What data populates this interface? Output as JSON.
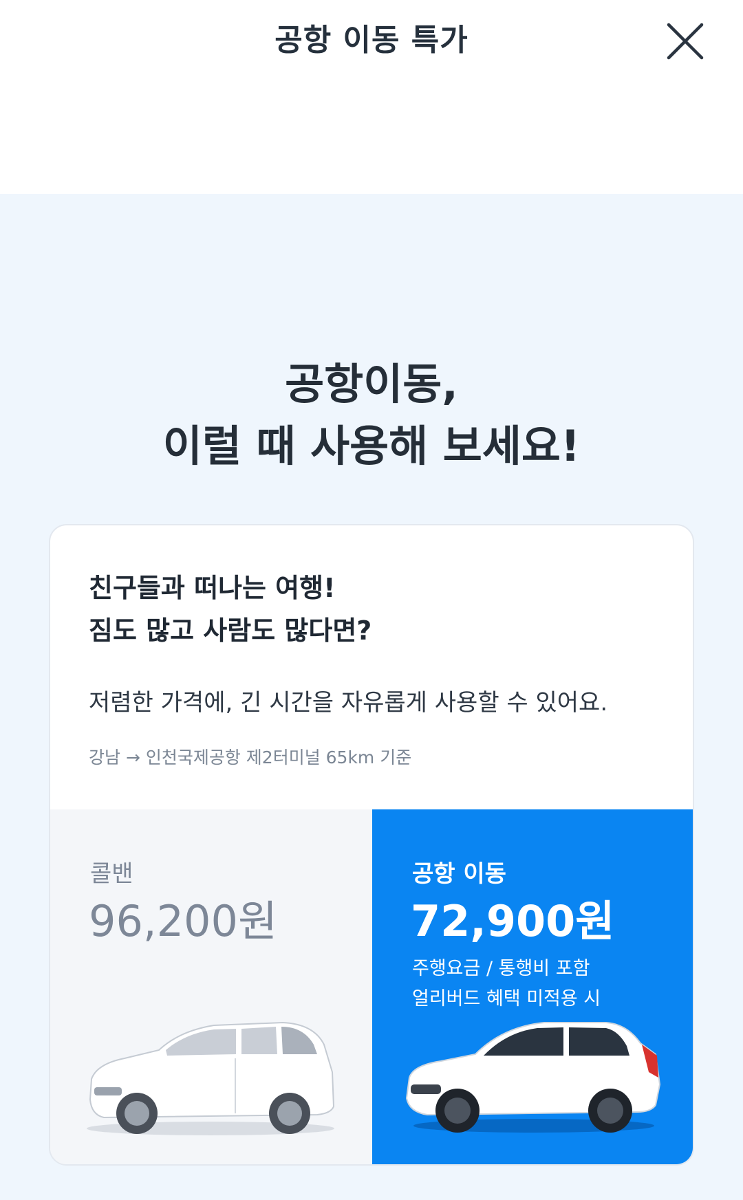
{
  "header": {
    "title": "공항 이동 특가",
    "close_icon": "close-icon"
  },
  "main": {
    "headline_line1": "공항이동,",
    "headline_line2": "이럴 때 사용해 보세요!"
  },
  "card": {
    "title_line1": "친구들과 떠나는 여행!",
    "title_line2": "짐도 많고 사람도 많다면?",
    "description": "저렴한 가격에, 긴 시간을 자유롭게 사용할 수 있어요.",
    "note": "강남 → 인천국제공항 제2터미널 65km 기준",
    "left": {
      "label": "콜밴",
      "price": "96,200원",
      "image_icon": "minivan-icon"
    },
    "right": {
      "label": "공항 이동",
      "price": "72,900원",
      "sub_line1": "주행요금 / 통행비 포함",
      "sub_line2": "얼리버드 혜택 미적용 시",
      "image_icon": "suv-icon"
    }
  },
  "colors": {
    "background": "#eff6fd",
    "accent": "#0a85f2",
    "text_dark": "#252e38",
    "text_muted": "#7d8797"
  }
}
